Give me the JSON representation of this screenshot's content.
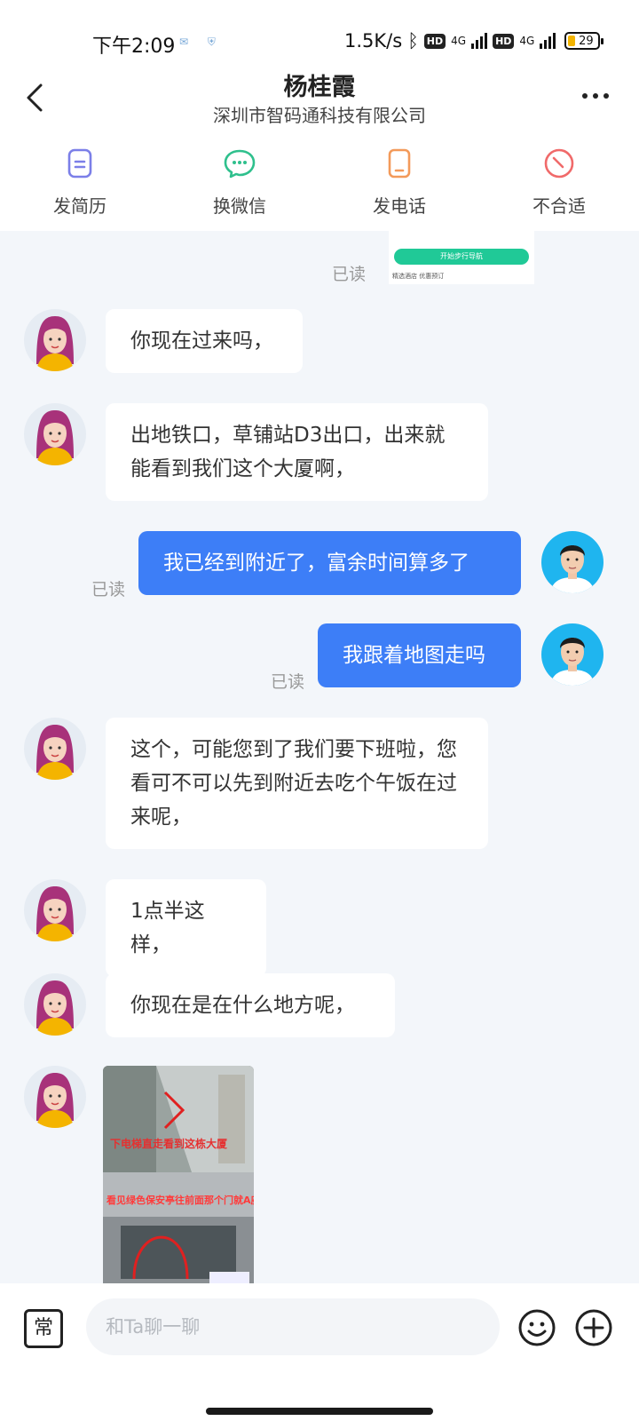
{
  "status": {
    "time": "下午2:09",
    "net_speed": "1.5K/s",
    "net1": "4G",
    "net2": "4G",
    "hd": "HD",
    "battery": "29"
  },
  "header": {
    "name": "杨桂霞",
    "company": "深圳市智码通科技有限公司"
  },
  "actions": [
    {
      "label": "发简历",
      "icon": "resume-icon",
      "color": "#7b7fe8"
    },
    {
      "label": "换微信",
      "icon": "wechat-icon",
      "color": "#2fc08d"
    },
    {
      "label": "发电话",
      "icon": "phone-icon",
      "color": "#f39a5a"
    },
    {
      "label": "不合适",
      "icon": "not-suitable-icon",
      "color": "#f06a6a"
    }
  ],
  "chat": {
    "read_label": "已读",
    "preview_button": "开始步行导航",
    "preview_footer": "精选酒店 优惠预订",
    "messages": [
      {
        "from": "other",
        "text": "你现在过来吗，"
      },
      {
        "from": "other",
        "text": "出地铁口，草铺站D3出口，出来就能看到我们这个大厦啊，"
      },
      {
        "from": "self",
        "text": "我已经到附近了，富余时间算多了"
      },
      {
        "from": "self",
        "text": "我跟着地图走吗"
      },
      {
        "from": "other",
        "text": "这个，可能您到了我们要下班啦，您看可不可以先到附近去吃个午饭在过来呢，"
      },
      {
        "from": "other",
        "text": "1点半这样，"
      },
      {
        "from": "other",
        "text": "你现在是在什么地方呢，"
      }
    ],
    "photo_captions": [
      "下电梯直走看到这栋大厦",
      "看见绿色保安亭往前面那个门就A座入口"
    ]
  },
  "input": {
    "common_label": "常",
    "placeholder": "和Ta聊一聊"
  },
  "colors": {
    "self_bubble": "#3d7ef7",
    "background": "#f3f6fa"
  }
}
